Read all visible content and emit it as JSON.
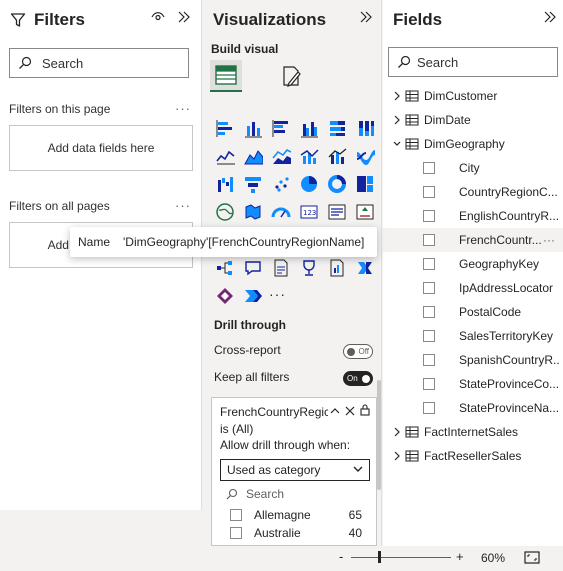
{
  "filters": {
    "title": "Filters",
    "search_placeholder": "Search",
    "this_page_label": "Filters on this page",
    "this_page_drop": "Add data fields here",
    "all_pages_label": "Filters on all pages",
    "all_pages_drop": "Add data fields here"
  },
  "visualizations": {
    "title": "Visualizations",
    "build_label": "Build visual",
    "more_visuals": "···",
    "drill_through_label": "Drill through",
    "cross_report_label": "Cross-report",
    "cross_report_state": "Off",
    "keep_filters_label": "Keep all filters",
    "keep_filters_state": "On",
    "drill_field": "FrenchCountryRegic",
    "drill_is": "is (All)",
    "allow_label": "Allow drill through when:",
    "allow_value": "Used as category",
    "search_placeholder": "Search",
    "values": [
      {
        "label": "Allemagne",
        "count": "65"
      },
      {
        "label": "Australie",
        "count": "40"
      }
    ]
  },
  "fields": {
    "title": "Fields",
    "search_placeholder": "Search",
    "tables": [
      {
        "label": "DimCustomer"
      },
      {
        "label": "DimDate"
      },
      {
        "label": "DimGeography"
      }
    ],
    "geo_columns": [
      {
        "label": "City"
      },
      {
        "label": "CountryRegionC..."
      },
      {
        "label": "EnglishCountryR..."
      },
      {
        "label": "FrenchCountr..."
      },
      {
        "label": "GeographyKey"
      },
      {
        "label": "IpAddressLocator"
      },
      {
        "label": "PostalCode"
      },
      {
        "label": "SalesTerritoryKey"
      },
      {
        "label": "SpanishCountryR..."
      },
      {
        "label": "StateProvinceCo..."
      },
      {
        "label": "StateProvinceNa..."
      }
    ],
    "more_tables": [
      {
        "label": "FactInternetSales"
      },
      {
        "label": "FactResellerSales"
      }
    ],
    "row_more": "···"
  },
  "tooltip": {
    "key": "Name",
    "value": "'DimGeography'[FrenchCountryRegionName]"
  },
  "status": {
    "zoom_minus": "-",
    "zoom_plus": "+",
    "zoom_value": "60%"
  },
  "colors": {
    "accent_green": "#217346",
    "viz_blue": "#118dff",
    "viz_dark": "#12239e"
  }
}
